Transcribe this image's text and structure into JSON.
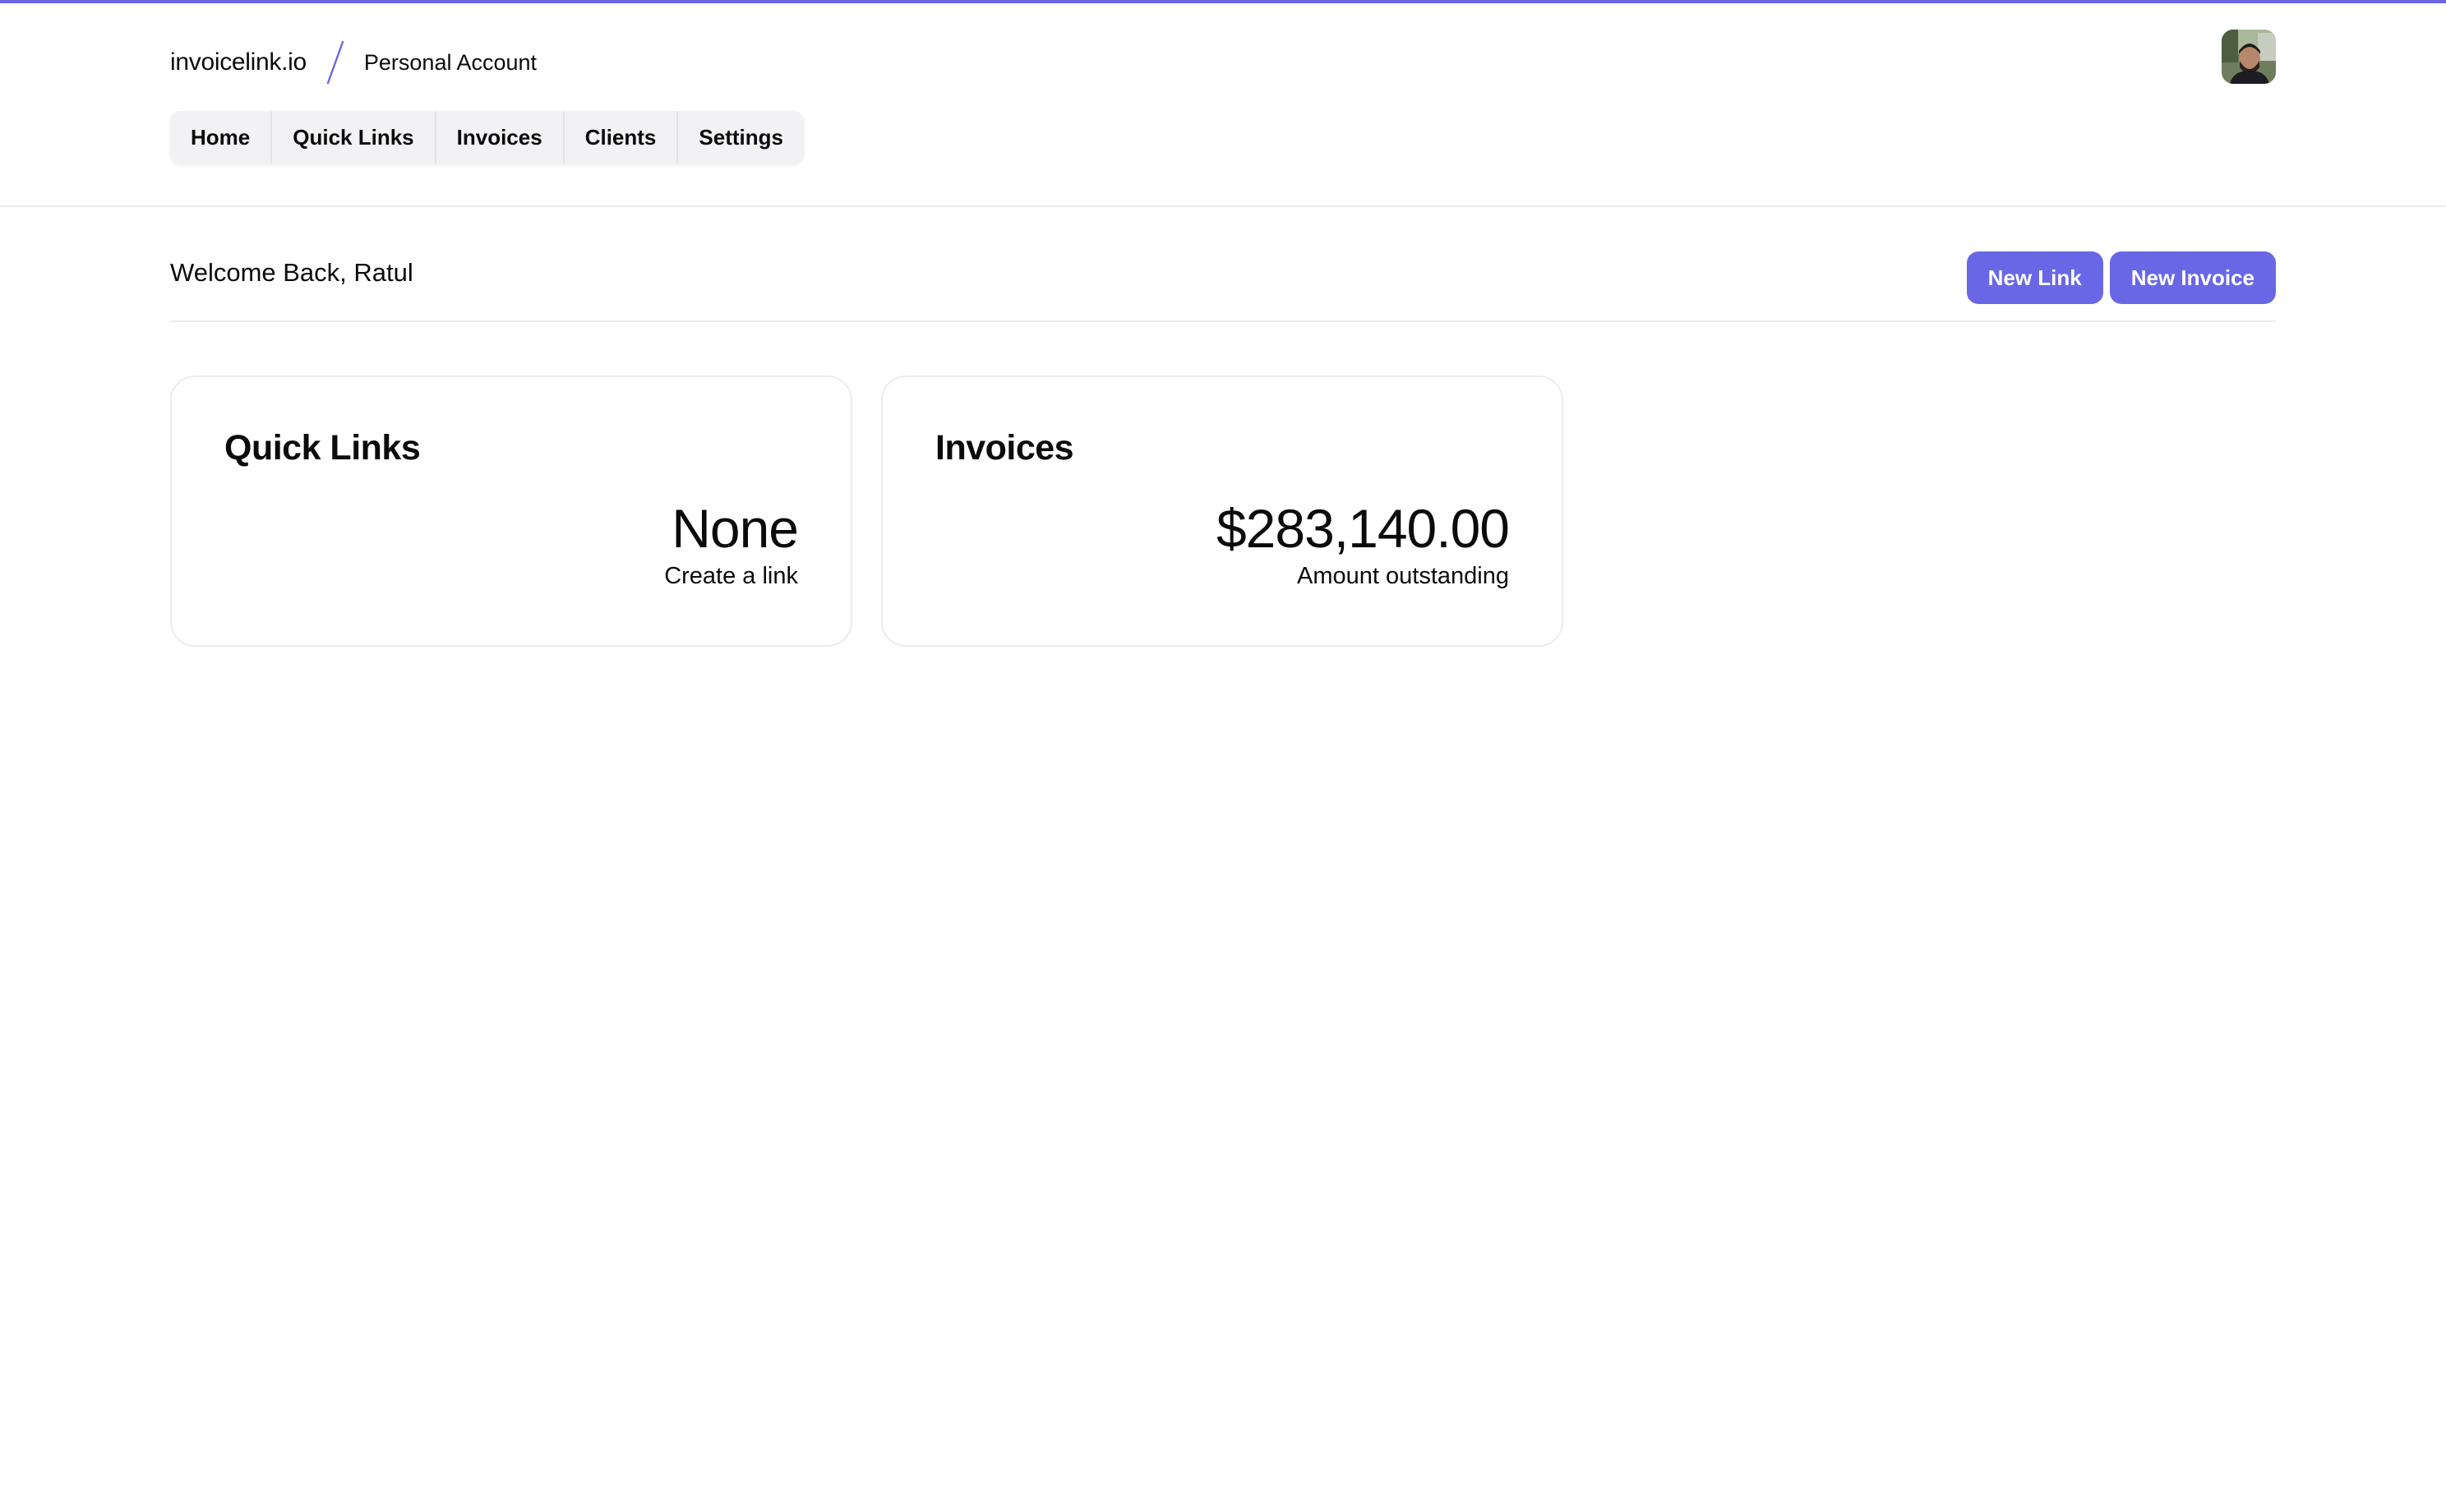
{
  "colors": {
    "accent": "#6a67e6",
    "text": "#0b0b0b",
    "border": "#ececee",
    "nav_bg": "#f2f2f4"
  },
  "header": {
    "brand": "invoicelink.io",
    "separator_icon": "slash-icon",
    "account": "Personal Account",
    "avatar_icon": "user-avatar"
  },
  "nav": {
    "items": [
      {
        "label": "Home"
      },
      {
        "label": "Quick Links"
      },
      {
        "label": "Invoices"
      },
      {
        "label": "Clients"
      },
      {
        "label": "Settings"
      }
    ]
  },
  "main": {
    "welcome": "Welcome Back, Ratul",
    "actions": {
      "new_link": "New Link",
      "new_invoice": "New Invoice"
    },
    "cards": {
      "quick_links": {
        "title": "Quick Links",
        "value": "None",
        "subtitle": "Create a link"
      },
      "invoices": {
        "title": "Invoices",
        "value": "$283,140.00",
        "subtitle": "Amount outstanding"
      }
    }
  }
}
